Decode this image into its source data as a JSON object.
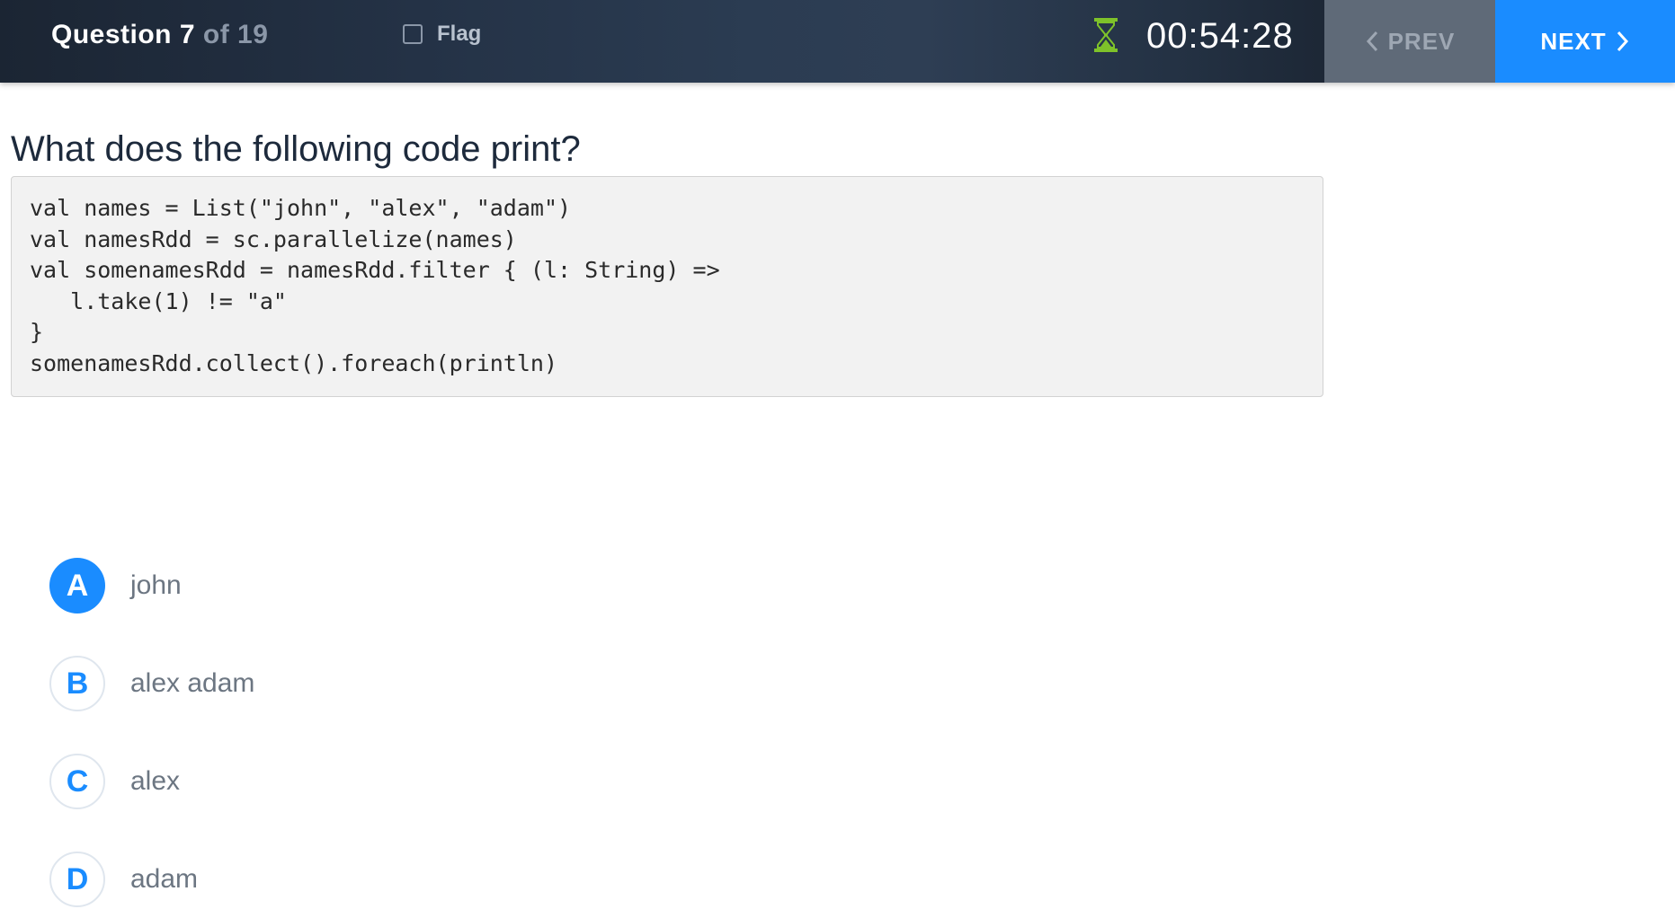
{
  "header": {
    "question_label": "Question",
    "question_number": "7",
    "question_total": "of 19",
    "flag_label": "Flag",
    "flag_checked": false,
    "timer": "00:54:28",
    "prev_label": "PREV",
    "next_label": "NEXT"
  },
  "question": {
    "text": "What does the following code print?",
    "code_lines": [
      "val names = List(\"john\", \"alex\", \"adam\")",
      "val namesRdd = sc.parallelize(names)",
      "val somenamesRdd = namesRdd.filter { (l: String) =>",
      "   l.take(1) != \"a\"",
      "}",
      "somenamesRdd.collect().foreach(println)"
    ]
  },
  "options": [
    {
      "letter": "A",
      "text": "john",
      "selected": true
    },
    {
      "letter": "B",
      "text": "alex adam",
      "selected": false
    },
    {
      "letter": "C",
      "text": "alex",
      "selected": false
    },
    {
      "letter": "D",
      "text": "adam",
      "selected": false
    }
  ],
  "colors": {
    "accent": "#1a8cff",
    "topbar": "#243246",
    "prev_button": "#5f6a78",
    "timer_icon": "#7ec22a"
  },
  "icons": {
    "flag": "checkbox-icon",
    "timer": "hourglass-icon",
    "prev": "chevron-left-icon",
    "next": "chevron-right-icon"
  }
}
